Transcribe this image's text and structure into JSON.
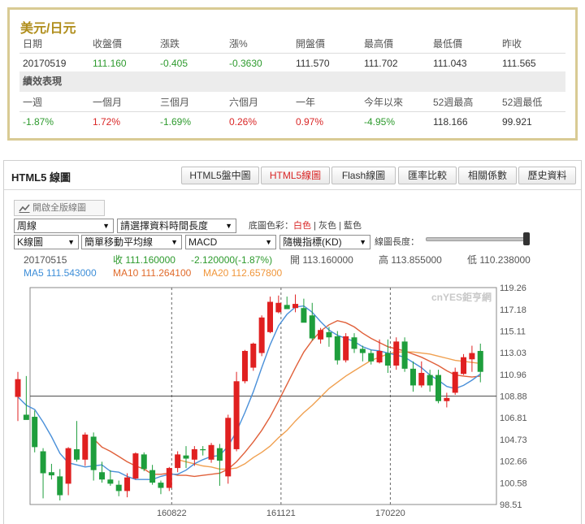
{
  "quote": {
    "title": "美元/日元",
    "headers": [
      "日期",
      "收盤價",
      "漲跌",
      "漲%",
      "開盤價",
      "最高價",
      "最低價",
      "昨收"
    ],
    "values": [
      "20170519",
      "111.160",
      "-0.405",
      "-0.3630",
      "111.570",
      "111.702",
      "111.043",
      "111.565"
    ],
    "perf_title": "績效表現",
    "perf_headers": [
      "一週",
      "一個月",
      "三個月",
      "六個月",
      "一年",
      "今年以來",
      "52週最高",
      "52週最低"
    ],
    "perf_values": [
      "-1.87%",
      "1.72%",
      "-1.69%",
      "0.26%",
      "0.97%",
      "-4.95%",
      "118.166",
      "99.921"
    ]
  },
  "chart_panel": {
    "title": "HTML5 線圖",
    "tabs": [
      "HTML5盤中圖",
      "HTML5線圖",
      "Flash線圖",
      "匯率比較",
      "相關係數",
      "歷史資料"
    ],
    "active_tab": "HTML5線圖",
    "fullview_label": "開啟全版線圖",
    "period_select": "周線",
    "range_select": "請選擇資料時間長度",
    "bg_label": "底圖色彩：",
    "bg_options": [
      "白色",
      "灰色",
      "藍色"
    ],
    "bg_selected": "白色",
    "kline_select": "K線圖",
    "ma_select": "簡單移動平均線",
    "macd_select": "MACD",
    "kd_select": "隨機指標(KD)",
    "length_label": "線圖長度：",
    "length_value": 1.0,
    "info_date": "20170515",
    "info_close": "收 111.160000",
    "info_change": "-2.120000(-1.87%)",
    "info_open": "開 113.160000",
    "info_high": "高 113.855000",
    "info_low": "低 110.238000",
    "ma5_text": "MA5 111.543000",
    "ma10_text": "MA10 111.264100",
    "ma20_text": "MA20 112.657800",
    "watermark": "cnYES鉅亨網",
    "colors": {
      "up": "#e02020",
      "down": "#1e9e3c",
      "ma5": "#4a90d9",
      "ma10": "#e0603a",
      "ma20": "#f0a050",
      "accent": "#d92626"
    }
  },
  "chart_data": {
    "type": "candlestick",
    "ylim": [
      98.51,
      119.26
    ],
    "y_ticks": [
      "119.26",
      "117.18",
      "115.11",
      "113.03",
      "110.96",
      "108.88",
      "106.81",
      "104.73",
      "102.66",
      "100.58",
      "98.51"
    ],
    "x_ticks": [
      "160822",
      "161121",
      "170220"
    ],
    "x_tick_index": [
      18,
      31,
      44
    ],
    "reference_line": 108.88,
    "candles": [
      {
        "o": 108.8,
        "h": 111.2,
        "l": 106.5,
        "c": 110.5
      },
      {
        "o": 107.1,
        "h": 110.8,
        "l": 106.7,
        "c": 106.6
      },
      {
        "o": 106.9,
        "h": 107.5,
        "l": 103.5,
        "c": 104.0
      },
      {
        "o": 103.6,
        "h": 103.9,
        "l": 99.1,
        "c": 101.5
      },
      {
        "o": 101.6,
        "h": 102.4,
        "l": 100.9,
        "c": 101.3
      },
      {
        "o": 101.2,
        "h": 101.9,
        "l": 98.9,
        "c": 99.4
      },
      {
        "o": 100.5,
        "h": 104.0,
        "l": 99.4,
        "c": 103.9
      },
      {
        "o": 103.8,
        "h": 106.5,
        "l": 102.6,
        "c": 102.8
      },
      {
        "o": 102.8,
        "h": 105.4,
        "l": 102.2,
        "c": 105.2
      },
      {
        "o": 105.0,
        "h": 105.4,
        "l": 100.8,
        "c": 101.8
      },
      {
        "o": 101.6,
        "h": 102.6,
        "l": 100.6,
        "c": 100.9
      },
      {
        "o": 100.9,
        "h": 101.8,
        "l": 100.3,
        "c": 100.5
      },
      {
        "o": 100.4,
        "h": 100.8,
        "l": 99.3,
        "c": 99.8
      },
      {
        "o": 99.8,
        "h": 101.5,
        "l": 99.2,
        "c": 101.1
      },
      {
        "o": 101.0,
        "h": 103.5,
        "l": 100.9,
        "c": 103.4
      },
      {
        "o": 103.3,
        "h": 103.5,
        "l": 101.7,
        "c": 101.9
      },
      {
        "o": 101.8,
        "h": 102.3,
        "l": 100.4,
        "c": 100.6
      },
      {
        "o": 100.6,
        "h": 100.8,
        "l": 99.5,
        "c": 100.1
      },
      {
        "o": 100.1,
        "h": 102.1,
        "l": 99.8,
        "c": 102.0
      },
      {
        "o": 102.0,
        "h": 103.6,
        "l": 101.6,
        "c": 103.3
      },
      {
        "o": 103.2,
        "h": 104.1,
        "l": 102.0,
        "c": 102.9
      },
      {
        "o": 102.8,
        "h": 104.1,
        "l": 102.2,
        "c": 103.8
      },
      {
        "o": 103.8,
        "h": 104.1,
        "l": 103.2,
        "c": 103.7
      },
      {
        "o": 102.8,
        "h": 104.4,
        "l": 102.5,
        "c": 104.2
      },
      {
        "o": 103.9,
        "h": 104.3,
        "l": 100.3,
        "c": 102.7
      },
      {
        "o": 101.2,
        "h": 107.1,
        "l": 100.5,
        "c": 106.8
      },
      {
        "o": 103.8,
        "h": 111.2,
        "l": 103.6,
        "c": 110.3
      },
      {
        "o": 110.3,
        "h": 113.3,
        "l": 110.1,
        "c": 113.2
      },
      {
        "o": 111.6,
        "h": 114.0,
        "l": 111.3,
        "c": 113.9
      },
      {
        "o": 113.0,
        "h": 116.6,
        "l": 112.7,
        "c": 116.4
      },
      {
        "o": 115.0,
        "h": 118.4,
        "l": 114.9,
        "c": 117.9
      },
      {
        "o": 116.9,
        "h": 118.5,
        "l": 116.8,
        "c": 117.8
      },
      {
        "o": 117.6,
        "h": 118.4,
        "l": 117.3,
        "c": 117.2
      },
      {
        "o": 117.3,
        "h": 118.6,
        "l": 116.9,
        "c": 117.7
      },
      {
        "o": 117.3,
        "h": 118.2,
        "l": 116.3,
        "c": 115.9
      },
      {
        "o": 116.6,
        "h": 117.8,
        "l": 114.2,
        "c": 114.4
      },
      {
        "o": 114.3,
        "h": 115.4,
        "l": 113.9,
        "c": 115.2
      },
      {
        "o": 115.0,
        "h": 115.5,
        "l": 113.6,
        "c": 114.5
      },
      {
        "o": 114.6,
        "h": 115.1,
        "l": 111.9,
        "c": 112.3
      },
      {
        "o": 112.3,
        "h": 114.9,
        "l": 112.1,
        "c": 114.6
      },
      {
        "o": 114.5,
        "h": 114.9,
        "l": 113.0,
        "c": 113.4
      },
      {
        "o": 113.4,
        "h": 113.7,
        "l": 112.2,
        "c": 113.0
      },
      {
        "o": 113.0,
        "h": 113.3,
        "l": 111.9,
        "c": 112.2
      },
      {
        "o": 112.1,
        "h": 114.3,
        "l": 112.0,
        "c": 113.2
      },
      {
        "o": 113.0,
        "h": 114.3,
        "l": 111.1,
        "c": 111.8
      },
      {
        "o": 111.8,
        "h": 114.5,
        "l": 111.4,
        "c": 114.1
      },
      {
        "o": 114.1,
        "h": 114.5,
        "l": 111.2,
        "c": 111.5
      },
      {
        "o": 111.5,
        "h": 112.2,
        "l": 109.3,
        "c": 109.9
      },
      {
        "o": 109.9,
        "h": 112.2,
        "l": 109.7,
        "c": 111.1
      },
      {
        "o": 110.9,
        "h": 111.4,
        "l": 109.3,
        "c": 109.9
      },
      {
        "o": 110.9,
        "h": 111.4,
        "l": 108.2,
        "c": 108.4
      },
      {
        "o": 108.4,
        "h": 109.2,
        "l": 107.8,
        "c": 108.7
      },
      {
        "o": 109.2,
        "h": 111.6,
        "l": 109.0,
        "c": 111.2
      },
      {
        "o": 111.0,
        "h": 112.9,
        "l": 110.9,
        "c": 112.6
      },
      {
        "o": 112.4,
        "h": 113.7,
        "l": 111.2,
        "c": 113.0
      },
      {
        "o": 113.2,
        "h": 113.9,
        "l": 110.2,
        "c": 111.2
      }
    ],
    "ma5": [
      108.8,
      108.0,
      107.6,
      106.4,
      105.0,
      103.4,
      102.5,
      102.3,
      102.1,
      102.2,
      102.3,
      101.7,
      101.6,
      101.2,
      100.9,
      100.9,
      100.9,
      101.2,
      101.4,
      101.4,
      101.8,
      102.4,
      102.8,
      103.1,
      103.2,
      104.1,
      105.5,
      107.3,
      109.3,
      111.6,
      113.8,
      115.6,
      116.7,
      117.4,
      117.5,
      116.9,
      116.0,
      115.2,
      114.7,
      114.4,
      114.1,
      113.6,
      113.3,
      113.2,
      113.0,
      112.8,
      112.6,
      112.1,
      111.6,
      110.9,
      110.4,
      109.8,
      109.6,
      109.9,
      110.4,
      111.0
    ],
    "ma10": [
      null,
      null,
      null,
      null,
      null,
      null,
      null,
      null,
      null,
      104.8,
      104.0,
      103.6,
      103.1,
      102.6,
      102.2,
      101.9,
      101.4,
      101.4,
      101.5,
      101.3,
      101.3,
      101.2,
      101.3,
      101.4,
      101.5,
      101.9,
      102.6,
      103.5,
      104.5,
      105.6,
      106.9,
      108.4,
      110.0,
      111.6,
      113.1,
      114.2,
      115.1,
      115.7,
      116.1,
      115.9,
      115.5,
      114.9,
      114.4,
      114.0,
      113.6,
      113.4,
      113.2,
      112.9,
      112.6,
      112.2,
      111.8,
      111.3,
      110.9,
      110.8,
      110.7,
      110.8
    ],
    "ma20": [
      null,
      null,
      null,
      null,
      null,
      null,
      null,
      null,
      null,
      null,
      null,
      null,
      null,
      null,
      null,
      null,
      null,
      null,
      null,
      102.8,
      102.6,
      102.4,
      102.2,
      102.1,
      101.9,
      101.9,
      102.0,
      102.4,
      103.0,
      103.5,
      104.1,
      104.9,
      105.6,
      106.5,
      107.3,
      108.0,
      108.8,
      109.6,
      110.2,
      110.8,
      111.3,
      111.8,
      112.3,
      112.6,
      112.9,
      113.1,
      113.1,
      113.1,
      113.0,
      112.9,
      112.7,
      112.5,
      112.3,
      112.2,
      112.1,
      112.0
    ]
  }
}
